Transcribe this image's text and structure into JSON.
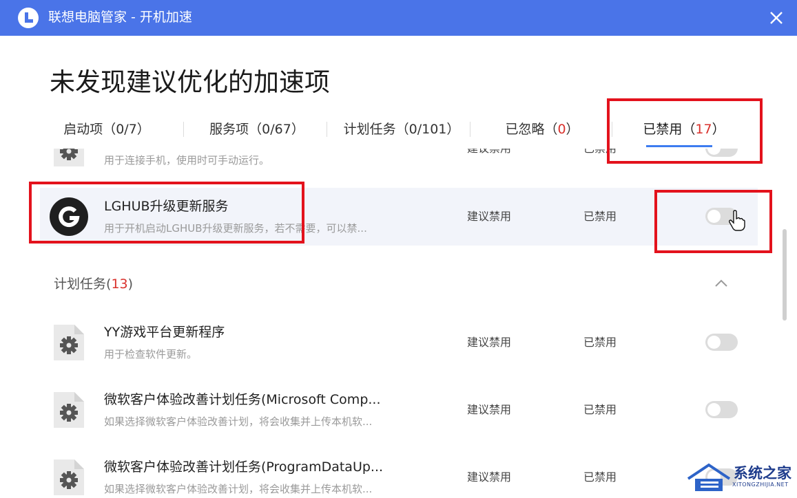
{
  "window": {
    "title": "联想电脑管家 - 开机加速",
    "accent": "#4a74e8"
  },
  "headline": "未发现建议优化的加速项",
  "tabs": [
    {
      "label": "启动项（0/7）"
    },
    {
      "label": "服务项（0/67）"
    },
    {
      "label": "计划任务（0/101）"
    },
    {
      "label_pre": "已忽略（",
      "count": "0",
      "label_post": "）"
    },
    {
      "label_pre": "已禁用（",
      "count": "17",
      "label_post": "）",
      "active": true
    }
  ],
  "services": [
    {
      "name": "",
      "desc": "用于连接手机，使用时可手动运行。",
      "suggestion": "建议禁用",
      "status": "已禁用",
      "icon": "gear-file-icon"
    },
    {
      "name": "LGHUB升级更新服务",
      "desc": "用于开机启动LGHUB升级更新服务，若不需要，可以禁...",
      "suggestion": "建议禁用",
      "status": "已禁用",
      "icon": "logitech-g-icon"
    }
  ],
  "section": {
    "label": "计划任务",
    "open": "(",
    "count": "13",
    "close": ")"
  },
  "tasks": [
    {
      "name": "YY游戏平台更新程序",
      "desc": "用于检查软件更新。",
      "suggestion": "建议禁用",
      "status": "已禁用"
    },
    {
      "name": "微软客户体验改善计划任务(Microsoft Comp...",
      "desc": "如果选择微软客户体验改善计划，将会收集并上传本机软...",
      "suggestion": "建议禁用",
      "status": "已禁用"
    },
    {
      "name": "微软客户体验改善计划任务(ProgramDataUp...",
      "desc": "如果选择微软客户体验改善计划，将会收集并上传本机软...",
      "suggestion": "建议禁用",
      "status": "已禁用"
    }
  ],
  "watermark": {
    "text": "系统之家",
    "sub": "XITONGZHIJIA.NET"
  },
  "colors": {
    "highlight_red": "#e3121c",
    "count_red": "#d9312c",
    "tab_underline": "#3d7cf0"
  }
}
